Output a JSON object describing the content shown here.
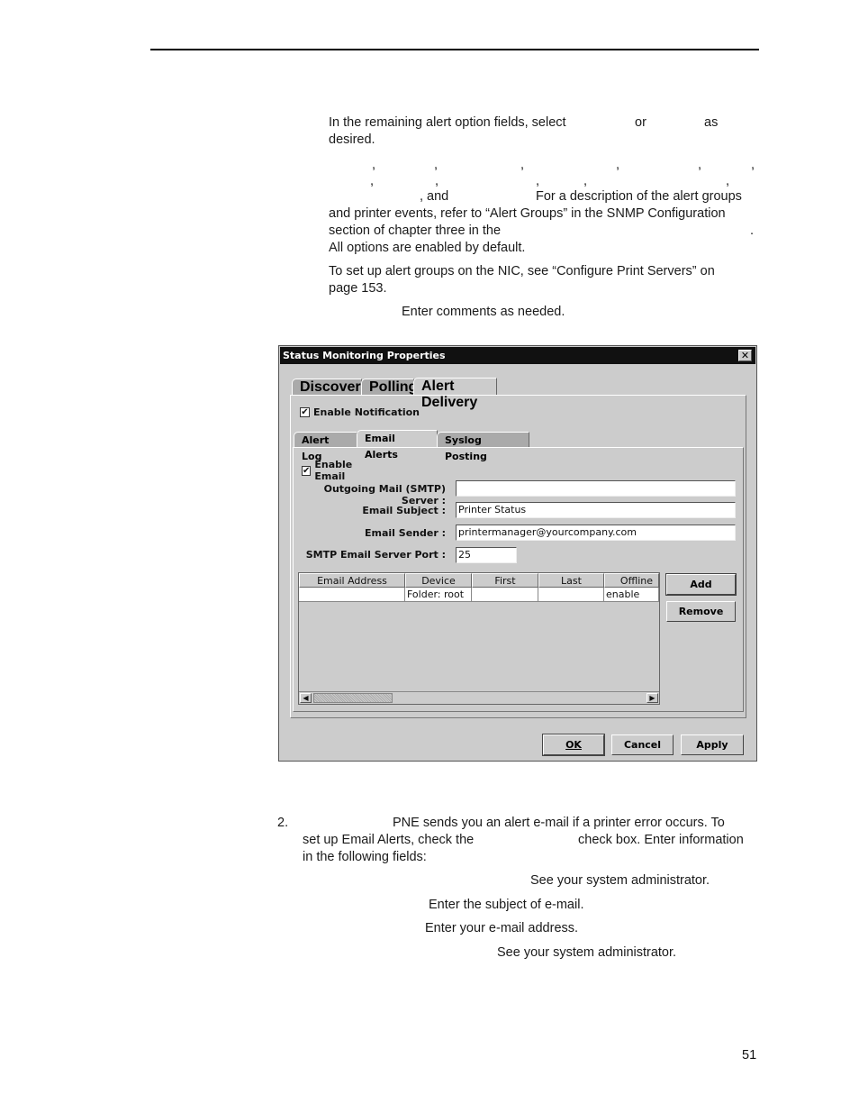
{
  "document": {
    "page_number": "51",
    "paragraphs": {
      "select_options": "In the remaining alert option fields, select",
      "select_or": "or",
      "select_as": "as",
      "select_desired": "desired.",
      "list_and": ", and",
      "desc_1": "For a description of the alert groups",
      "desc_2": "and printer events, refer to “Alert Groups” in the SNMP Configuration",
      "desc_3": "section of chapter three in the",
      "desc_3_end": ".",
      "desc_4": "All options are enabled by default.",
      "nic_1": "To set up alert groups on the NIC, see “Configure Print Servers” on",
      "nic_2": "page 153.",
      "comments": "Enter comments as needed.",
      "step2_num": "2.",
      "step2_1": "PNE sends you an alert e-mail if a printer error occurs. To",
      "step2_2a": "set up Email Alerts, check the",
      "step2_2b": "check box. Enter information",
      "step2_3": "in the following fields:",
      "field_smtp": "See your system administrator.",
      "field_subject": "Enter the subject of e-mail.",
      "field_sender": "Enter your e-mail address.",
      "field_port": "See your system administrator."
    }
  },
  "dialog": {
    "title": "Status Monitoring Properties",
    "close_glyph": "✕",
    "tabs": [
      {
        "label": "Discovery",
        "active": false
      },
      {
        "label": "Polling",
        "active": false
      },
      {
        "label": "Alert Delivery",
        "active": true
      }
    ],
    "enable_notification": {
      "label": "Enable Notification",
      "checked": true,
      "glyph": "✔"
    },
    "subtabs": [
      {
        "label": "Alert Log",
        "active": false
      },
      {
        "label": "Email Alerts",
        "active": true
      },
      {
        "label": "Syslog Posting",
        "active": false
      }
    ],
    "enable_email": {
      "label": "Enable Email",
      "checked": true,
      "glyph": "✔"
    },
    "fields": {
      "smtp_server": {
        "label": "Outgoing Mail (SMTP) Server :",
        "value": ""
      },
      "subject": {
        "label": "Email Subject :",
        "value": "Printer Status"
      },
      "sender": {
        "label": "Email Sender :",
        "value": "printermanager@yourcompany.com"
      },
      "port": {
        "label": "SMTP Email Server Port :",
        "value": "25"
      }
    },
    "table": {
      "columns": [
        "Email Address",
        "Device",
        "First",
        "Last",
        "Offline"
      ],
      "rows": [
        [
          "",
          "Folder: root",
          "",
          "",
          "enable"
        ]
      ]
    },
    "scroll_left": "◀",
    "scroll_right": "▶",
    "buttons": {
      "add": "Add",
      "remove": "Remove",
      "ok": "OK",
      "cancel": "Cancel",
      "apply": "Apply"
    }
  }
}
